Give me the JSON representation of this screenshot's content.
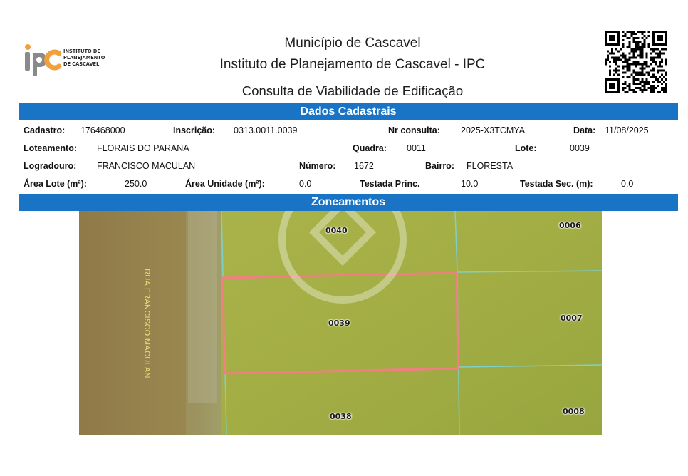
{
  "header": {
    "logo_lines": [
      "INSTITUTO DE",
      "PLANEJAMENTO",
      "DE CASCAVEL"
    ],
    "municipality": "Município de Cascavel",
    "institute": "Instituto de Planejamento de Cascavel - IPC",
    "document_title": "Consulta de Viabilidade de Edificação"
  },
  "sections": {
    "cadastral": "Dados Cadastrais",
    "zoning": "Zoneamentos"
  },
  "fields": {
    "cadastro": {
      "label": "Cadastro:",
      "value": "176468000"
    },
    "inscricao": {
      "label": "Inscrição:",
      "value": "0313.0011.0039"
    },
    "nr_consulta": {
      "label": "Nr consulta:",
      "value": "2025-X3TCMYA"
    },
    "data": {
      "label": "Data:",
      "value": "11/08/2025"
    },
    "loteamento": {
      "label": "Loteamento:",
      "value": "FLORAIS DO PARANA"
    },
    "quadra": {
      "label": "Quadra:",
      "value": "0011"
    },
    "lote": {
      "label": "Lote:",
      "value": "0039"
    },
    "logradouro": {
      "label": "Logradouro:",
      "value": "FRANCISCO MACULAN"
    },
    "numero": {
      "label": "Número:",
      "value": "1672"
    },
    "bairro": {
      "label": "Bairro:",
      "value": "FLORESTA"
    },
    "area_lote": {
      "label": "Área Lote (m²):",
      "value": "250.0"
    },
    "area_unidade": {
      "label": "Área Unidade (m²):",
      "value": "0.0"
    },
    "testada_princ": {
      "label": "Testada Princ.",
      "value": "10.0"
    },
    "testada_sec": {
      "label": "Testada Sec. (m):",
      "value": "0.0"
    }
  },
  "map": {
    "street_name": "RUA FRANCISCO MACULAN",
    "lots": [
      "0040",
      "0006",
      "0039",
      "0007",
      "0038",
      "0008"
    ]
  }
}
